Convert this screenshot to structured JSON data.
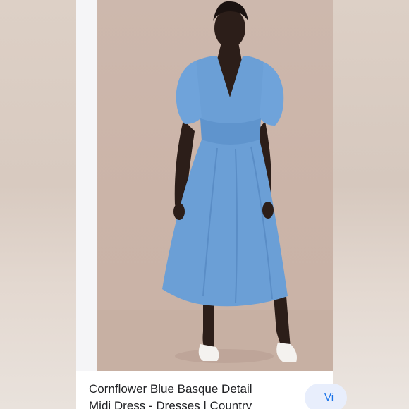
{
  "product": {
    "image_alt": "Blue midi dress with puffed sleeves worn by a model",
    "title_line1": "Cornflower Blue Basque Detail",
    "title_line2": "Midi Dress - Dresses | Country"
  },
  "actions": {
    "visit_label": "Vi"
  },
  "colors": {
    "dress": "#6b9fd6",
    "background": "#cdb8ad",
    "link": "#1a73e8"
  }
}
